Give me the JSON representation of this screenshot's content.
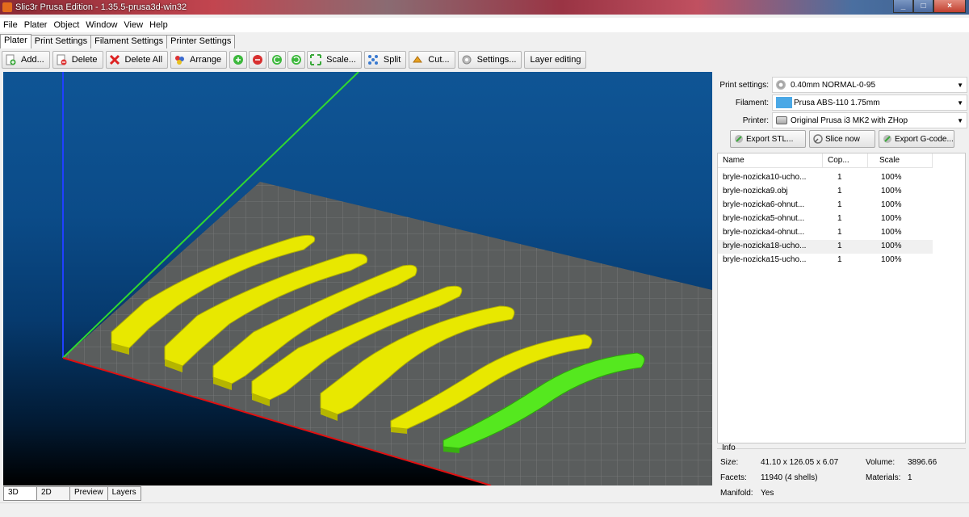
{
  "window": {
    "title": "Slic3r Prusa Edition - 1.35.5-prusa3d-win32",
    "minimize": "_",
    "maximize": "□",
    "close": "×"
  },
  "menu": [
    "File",
    "Plater",
    "Object",
    "Window",
    "View",
    "Help"
  ],
  "tabs": [
    "Plater",
    "Print Settings",
    "Filament Settings",
    "Printer Settings"
  ],
  "toolbar": {
    "add": "Add...",
    "delete": "Delete",
    "delete_all": "Delete All",
    "arrange": "Arrange",
    "scale": "Scale...",
    "split": "Split",
    "cut": "Cut...",
    "settings": "Settings...",
    "layer_editing": "Layer editing"
  },
  "settings": {
    "print_label": "Print settings:",
    "print_value": "0.40mm NORMAL-0-95",
    "filament_label": "Filament:",
    "filament_value": "Prusa ABS-110 1.75mm",
    "filament_color": "#4aa8e6",
    "printer_label": "Printer:",
    "printer_value": "Original Prusa i3 MK2 with ZHop"
  },
  "actions": {
    "export_stl": "Export STL...",
    "slice_now": "Slice now",
    "export_gcode": "Export G-code..."
  },
  "object_list": {
    "headers": [
      "Name",
      "Cop...",
      "Scale"
    ],
    "rows": [
      {
        "name": "bryle-nozicka10-ucho...",
        "copies": "1",
        "scale": "100%"
      },
      {
        "name": "bryle-nozicka9.obj",
        "copies": "1",
        "scale": "100%"
      },
      {
        "name": "bryle-nozicka6-ohnut...",
        "copies": "1",
        "scale": "100%"
      },
      {
        "name": "bryle-nozicka5-ohnut...",
        "copies": "1",
        "scale": "100%"
      },
      {
        "name": "bryle-nozicka4-ohnut...",
        "copies": "1",
        "scale": "100%"
      },
      {
        "name": "bryle-nozicka18-ucho...",
        "copies": "1",
        "scale": "100%"
      },
      {
        "name": "bryle-nozicka15-ucho...",
        "copies": "1",
        "scale": "100%"
      }
    ]
  },
  "info": {
    "title": "Info",
    "size_label": "Size:",
    "size_value": "41.10 x 126.05 x 6.07",
    "volume_label": "Volume:",
    "volume_value": "3896.66",
    "facets_label": "Facets:",
    "facets_value": "11940 (4 shells)",
    "materials_label": "Materials:",
    "materials_value": "1",
    "manifold_label": "Manifold:",
    "manifold_value": "Yes"
  },
  "view_tabs": [
    "3D",
    "2D",
    "Preview",
    "Layers"
  ],
  "colors": {
    "object": "#e8e800",
    "selected_object": "#55e81f",
    "bed": "#5a5d5d",
    "axis_x": "#e01010",
    "axis_y": "#30d830",
    "axis_z": "#2040ff"
  }
}
